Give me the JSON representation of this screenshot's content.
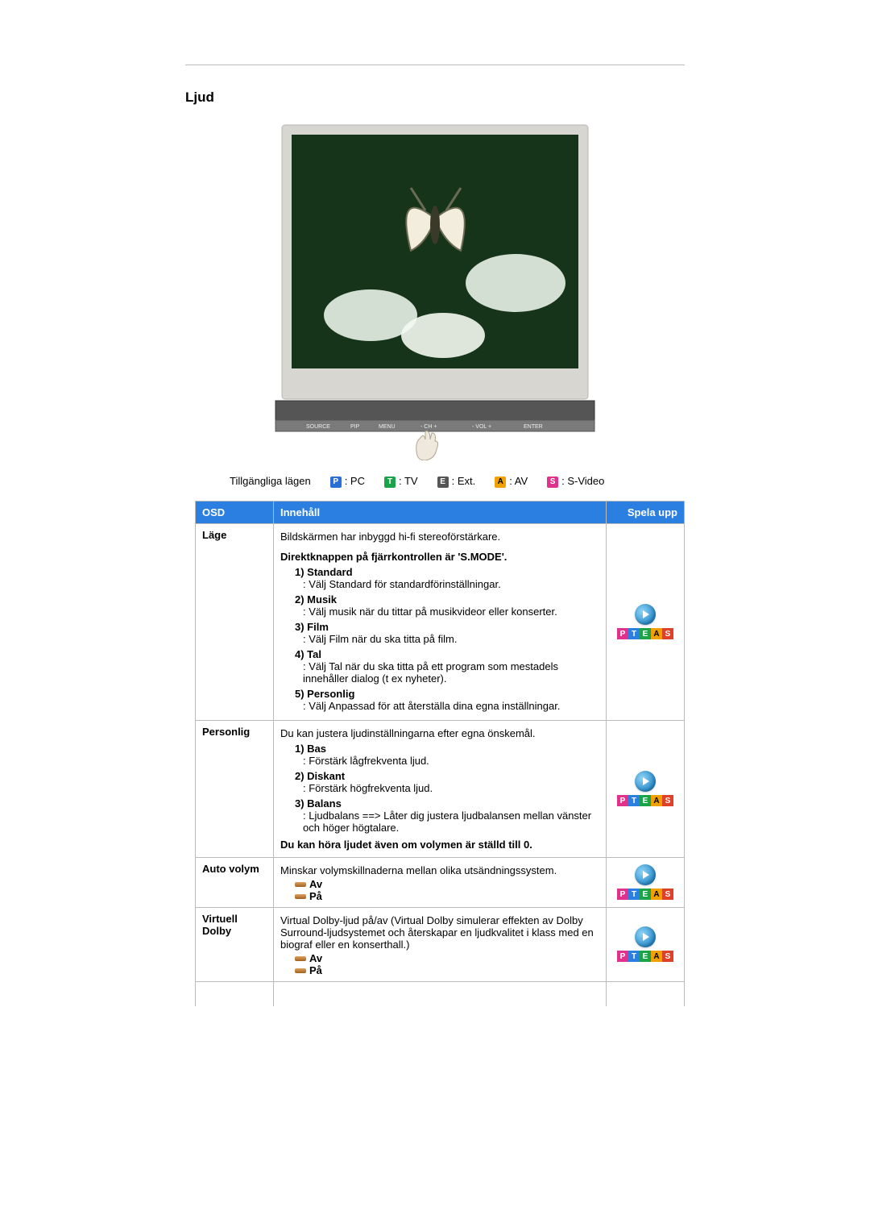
{
  "title": "Ljud",
  "modes": {
    "label": "Tillgängliga lägen",
    "p": "P",
    "p_text": ": PC",
    "t": "T",
    "t_text": ": TV",
    "e": "E",
    "e_text": ": Ext.",
    "a": "A",
    "a_text": ": AV",
    "s": "S",
    "s_text": ": S-Video"
  },
  "headers": {
    "osd": "OSD",
    "content": "Innehåll",
    "play": "Spela upp"
  },
  "pteas": {
    "p": "P",
    "t": "T",
    "e": "E",
    "a": "A",
    "s": "S"
  },
  "rows": {
    "r1": {
      "osd": "Läge",
      "intro": "Bildskärmen har inbyggd hi-fi stereoförstärkare.",
      "direct": "Direktknappen på fjärrkontrollen är 'S.MODE'.",
      "i1h": "1) Standard",
      "i1d": ": Välj Standard för standardförinställningar.",
      "i2h": "2) Musik",
      "i2d": ": Välj musik när du tittar på musikvideor eller konserter.",
      "i3h": "3) Film",
      "i3d": ": Välj Film när du ska titta på film.",
      "i4h": "4) Tal",
      "i4d": ": Välj Tal när du ska titta på ett program som mestadels innehåller dialog (t ex nyheter).",
      "i5h": "5) Personlig",
      "i5d": ": Välj Anpassad för att återställa dina egna inställningar."
    },
    "r2": {
      "osd": "Personlig",
      "intro": "Du kan justera ljudinställningarna efter egna önskemål.",
      "i1h": "1) Bas",
      "i1d": ": Förstärk lågfrekventa ljud.",
      "i2h": "2) Diskant",
      "i2d": ": Förstärk högfrekventa ljud.",
      "i3h": "3) Balans",
      "i3d": ": Ljudbalans ==> Låter dig justera ljudbalansen mellan vänster och höger högtalare.",
      "note": "Du kan höra ljudet även om volymen är ställd till 0."
    },
    "r3": {
      "osd": "Auto volym",
      "intro": "Minskar volymskillnaderna mellan olika utsändningssystem.",
      "av": "Av",
      "pa": "På"
    },
    "r4": {
      "osd": "Virtuell Dolby",
      "intro": "Virtual Dolby-ljud på/av (Virtual Dolby simulerar effekten av Dolby Surround-ljudsystemet och återskapar en ljudkvalitet i klass med en biograf eller en konserthall.)",
      "av": "Av",
      "pa": "På"
    }
  }
}
